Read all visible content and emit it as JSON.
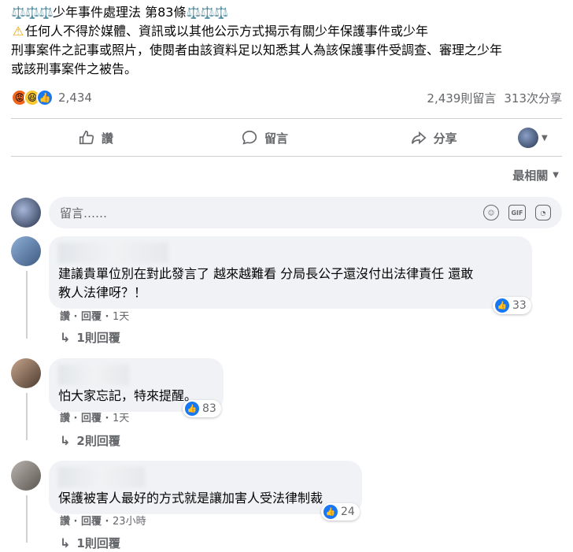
{
  "post": {
    "scale_glyphs_left": "⚖️⚖️⚖️",
    "title": "少年事件處理法 第83條",
    "scale_glyphs_right": "⚖️⚖️⚖️",
    "warning_icon": "warning-icon",
    "line1": "任何人不得於媒體、資訊或以其他公示方式揭示有關少年保護事件或少年",
    "line2": "刑事案件之記事或照片，使閱者由該資料足以知悉其人為該保護事件受調查、審理之少年",
    "line3": "或該刑事案件之被告。"
  },
  "stats": {
    "reaction_count": "2,434",
    "comments": "2,439則留言",
    "shares": "313次分享"
  },
  "actions": {
    "like": "讚",
    "comment": "留言",
    "share": "分享"
  },
  "sort": {
    "label": "最相關"
  },
  "composer": {
    "placeholder": "留言……"
  },
  "comments": [
    {
      "text_line1": "建議貴單位別在對此發言了 越來越難看 分局長公子還沒付出法律責任 還敢",
      "text_line2": "教人法律呀？！",
      "likes": "33",
      "like_label": "讚",
      "reply_label": "回覆",
      "time": "1天",
      "replies": "1則回覆"
    },
    {
      "text_line1": "怕大家忘記，特來提醒。",
      "likes": "83",
      "like_label": "讚",
      "reply_label": "回覆",
      "time": "1天",
      "replies": "2則回覆"
    },
    {
      "text_line1": "保護被害人最好的方式就是讓加害人受法律制裁",
      "likes": "24",
      "like_label": "讚",
      "reply_label": "回覆",
      "time": "23小時",
      "replies": "1則回覆"
    }
  ],
  "colors": {
    "like_blue": "#1877f2",
    "muted": "#65676b",
    "bubble": "#f0f2f5"
  }
}
